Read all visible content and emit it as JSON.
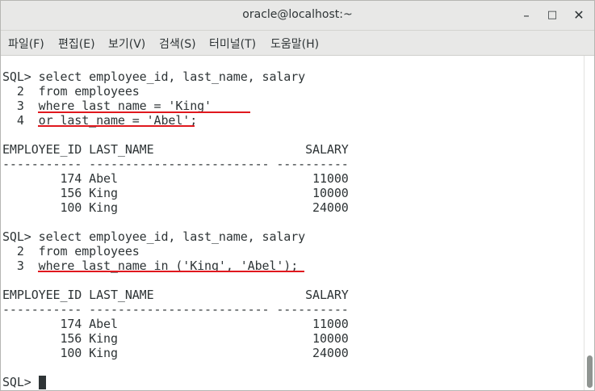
{
  "window": {
    "title": "oracle@localhost:~"
  },
  "controls": {
    "minimize": "–",
    "maximize": "□",
    "close": "✕"
  },
  "menu": [
    "파일(F)",
    "편집(E)",
    "보기(V)",
    "검색(S)",
    "터미널(T)",
    "도움말(H)"
  ],
  "terminal": {
    "lines": [
      "SQL> select employee_id, last_name, salary",
      "  2  from employees",
      "  3  where last_name = 'King'",
      "  4  or last_name = 'Abel';",
      "",
      "EMPLOYEE_ID LAST_NAME                     SALARY",
      "----------- ------------------------- ----------",
      "        174 Abel                           11000",
      "        156 King                           10000",
      "        100 King                           24000",
      "",
      "SQL> select employee_id, last_name, salary",
      "  2  from employees",
      "  3  where last_name in ('King', 'Abel');",
      "",
      "EMPLOYEE_ID LAST_NAME                     SALARY",
      "----------- ------------------------- ----------",
      "        174 Abel                           11000",
      "        156 King                           10000",
      "        100 King                           24000",
      "",
      "SQL> "
    ]
  },
  "colors": {
    "annotation": "#e0181e",
    "text": "#2e3436",
    "chrome": "#e8e8e7"
  }
}
